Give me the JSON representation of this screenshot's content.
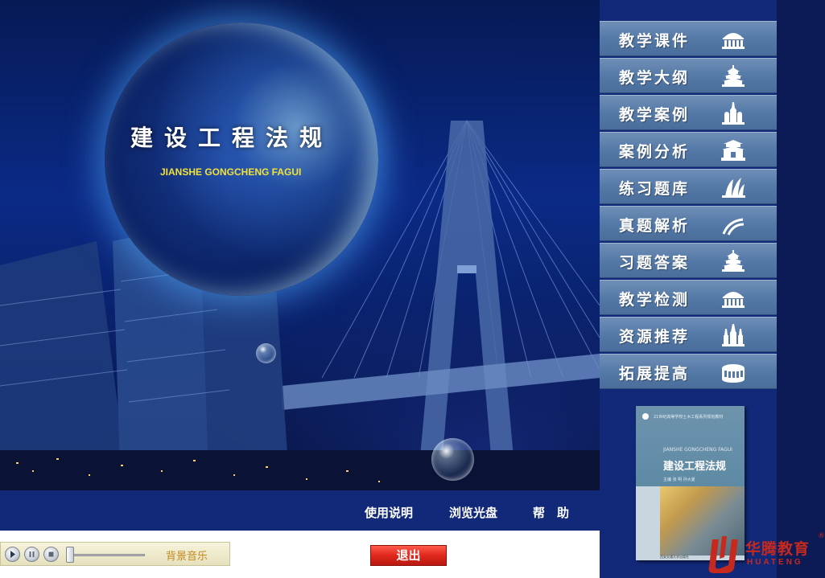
{
  "hero": {
    "title": "建设工程法规",
    "subtitle": "JIANSHE GONGCHENG FAGUI"
  },
  "menu": {
    "items": [
      {
        "label": "教学课件",
        "icon": "building-dome-icon"
      },
      {
        "label": "教学大纲",
        "icon": "temple-of-heaven-icon"
      },
      {
        "label": "教学案例",
        "icon": "kremlin-icon"
      },
      {
        "label": "案例分析",
        "icon": "gate-tower-icon"
      },
      {
        "label": "练习题库",
        "icon": "opera-house-icon"
      },
      {
        "label": "真题解析",
        "icon": "road-icon"
      },
      {
        "label": "习题答案",
        "icon": "temple-of-heaven-icon"
      },
      {
        "label": "教学检测",
        "icon": "building-dome-icon"
      },
      {
        "label": "资源推荐",
        "icon": "cathedral-icon"
      },
      {
        "label": "拓展提高",
        "icon": "colosseum-icon"
      }
    ]
  },
  "book": {
    "series": "21世纪高等学校土木工程系列规划教材",
    "pinyin": "JIANSHE GONGCHENG FAGUI",
    "title": "建设工程法规",
    "authors": "主编  张  明  孙大夏",
    "publisher": "西安交通大学出版社"
  },
  "bottom_links": {
    "manual": "使用说明",
    "browse_disc": "浏览光盘",
    "help": "帮　助"
  },
  "player": {
    "music_label": "背景音乐",
    "volume": 0.0
  },
  "exit_label": "退出",
  "logo": {
    "cn": "华腾教育",
    "en": "HUATENG",
    "reg": "®"
  },
  "colors": {
    "panel_blue": "#12297a",
    "menu_button": "#557aa7",
    "subtitle_yellow": "#f3e23a",
    "exit_red": "#e0281c",
    "logo_red": "#c62a1f"
  }
}
